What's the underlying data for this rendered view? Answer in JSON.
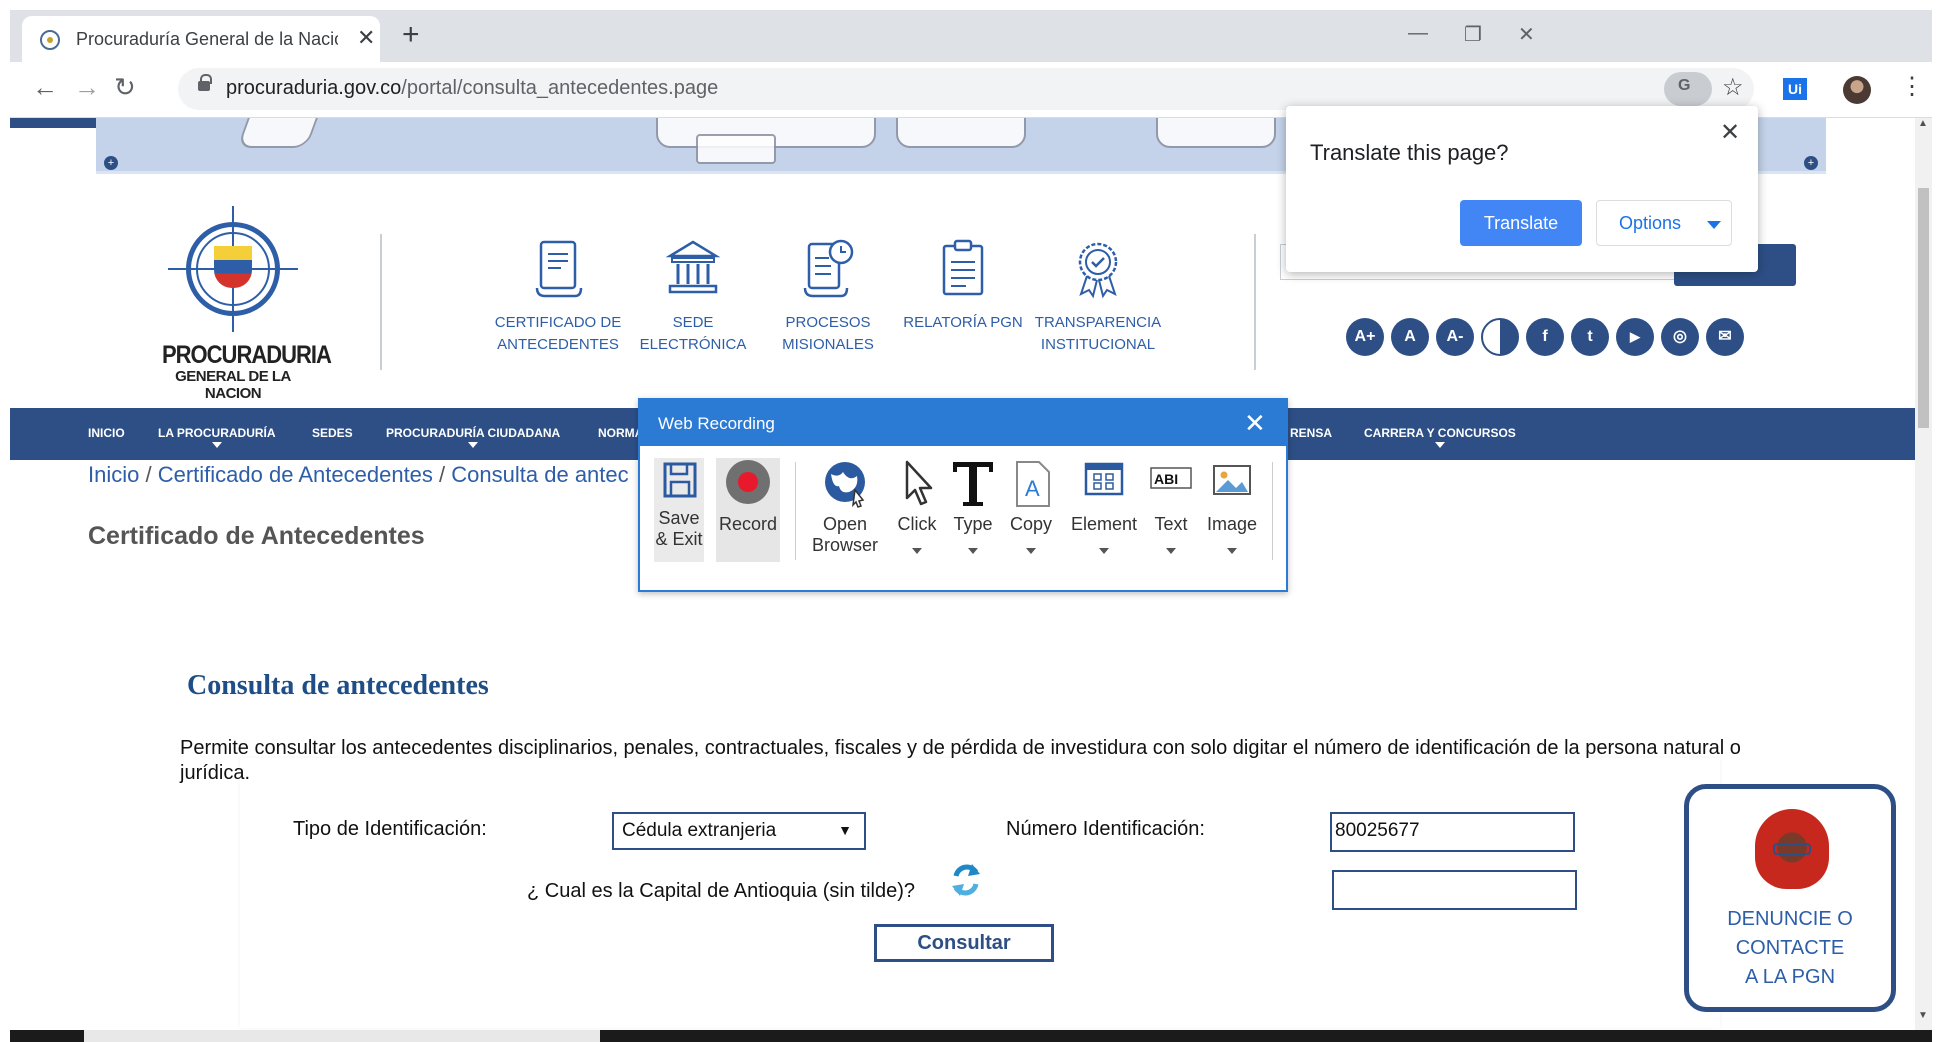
{
  "browser": {
    "tab_title": "Procuraduría General de la Nación",
    "tab_close": "✕",
    "new_tab": "+",
    "url_domain": "procuraduria.gov.co",
    "url_path": "/portal/consulta_antecedentes.page",
    "back_icon": "←",
    "forward_icon": "→",
    "reload_icon": "↻",
    "star_icon": "☆",
    "ext_label": "Ui",
    "menu_icon": "⋮",
    "minimize": "—",
    "restore": "❐",
    "close": "✕"
  },
  "header": {
    "logo_line1": "PROCURADURIA",
    "logo_line2": "GENERAL DE LA NACION",
    "services": [
      {
        "label": "CERTIFICADO DE ANTECEDENTES",
        "icon": "certificate-icon"
      },
      {
        "label": "SEDE ELECTRÓNICA",
        "icon": "building-icon"
      },
      {
        "label": "PROCESOS MISIONALES",
        "icon": "scroll-clock-icon"
      },
      {
        "label": "RELATORÍA PGN",
        "icon": "clipboard-icon"
      },
      {
        "label": "TRANSPARENCIA INSTITUCIONAL",
        "icon": "award-badge-icon"
      }
    ],
    "accessibility": [
      "A+",
      "A",
      "A-"
    ],
    "social": [
      "f",
      "t",
      "▶",
      "◎",
      "✉"
    ]
  },
  "nav": {
    "items": [
      "INICIO",
      "LA PROCURADURÍA",
      "SEDES",
      "PROCURADURÍA CIUDADANA",
      "NORMA",
      "RENSA",
      "CARRERA Y CONCURSOS"
    ]
  },
  "breadcrumb": {
    "inicio": "Inicio",
    "sep": "/",
    "certificado": "Certificado de Antecedentes",
    "consulta": "Consulta de antec"
  },
  "page": {
    "title": "Certificado de Antecedentes"
  },
  "form": {
    "heading": "Consulta de antecedentes",
    "description": "Permite consultar los antecedentes disciplinarios, penales, contractuales, fiscales y de pérdida de investidura con solo digitar el número de identificación de la persona natural o jurídica.",
    "tipo_label": "Tipo de Identificación:",
    "tipo_value": "Cédula extranjeria",
    "numero_label": "Número Identificación:",
    "numero_value": "80025677",
    "captcha_question": "¿ Cual es la Capital de Antioquia (sin tilde)?",
    "captcha_value": "",
    "submit_label": "Consultar"
  },
  "denuncie": {
    "line1": "DENUNCIE O",
    "line2": "CONTACTE",
    "line3": "A LA PGN"
  },
  "translate_popup": {
    "question": "Translate this page?",
    "translate_label": "Translate",
    "options_label": "Options",
    "close": "✕"
  },
  "recorder": {
    "title": "Web Recording",
    "close": "✕",
    "tools": [
      {
        "label1": "Save",
        "label2": "& Exit",
        "icon": "floppy-disk-icon"
      },
      {
        "label1": "Record",
        "label2": "",
        "icon": "record-icon"
      },
      {
        "label1": "Open",
        "label2": "Browser",
        "icon": "globe-icon"
      },
      {
        "label1": "Click",
        "label2": "",
        "icon": "cursor-icon"
      },
      {
        "label1": "Type",
        "label2": "",
        "icon": "type-icon"
      },
      {
        "label1": "Copy",
        "label2": "",
        "icon": "copy-icon"
      },
      {
        "label1": "Element",
        "label2": "",
        "icon": "element-icon"
      },
      {
        "label1": "Text",
        "label2": "",
        "icon": "text-icon"
      },
      {
        "label1": "Image",
        "label2": "",
        "icon": "image-icon"
      }
    ]
  },
  "colors": {
    "brand_blue": "#2d4f86",
    "link_blue": "#2d5ea7",
    "recorder_blue": "#2b7bd5",
    "translate_blue": "#4285f4"
  }
}
